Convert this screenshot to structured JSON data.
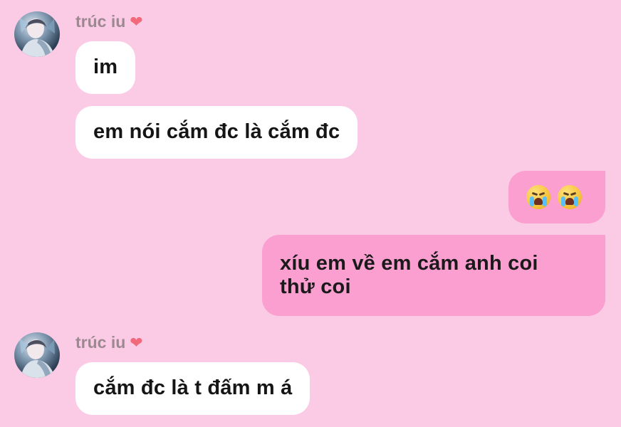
{
  "conversation": {
    "message_groups": [
      {
        "sender_name": "trúc iu",
        "messages": [
          "im",
          "em nói cắm đc là cắm đc"
        ]
      },
      {
        "sender_name": "",
        "messages": [
          "😭 😭",
          "xíu em về em cắm anh coi\nthử coi"
        ]
      },
      {
        "sender_name": "trúc iu",
        "messages": [
          "cắm đc là t đấm m á"
        ]
      }
    ]
  },
  "icons": {
    "heart": "heart-icon",
    "avatar": "avatar",
    "emoji": "loudly-crying-face-icon"
  },
  "colors": {
    "background": "#fbcbe6",
    "incoming_bubble": "#ffffff",
    "outgoing_bubble": "#fb9fd1",
    "sender_name": "#9d8891",
    "heart": "#f06a7c"
  }
}
